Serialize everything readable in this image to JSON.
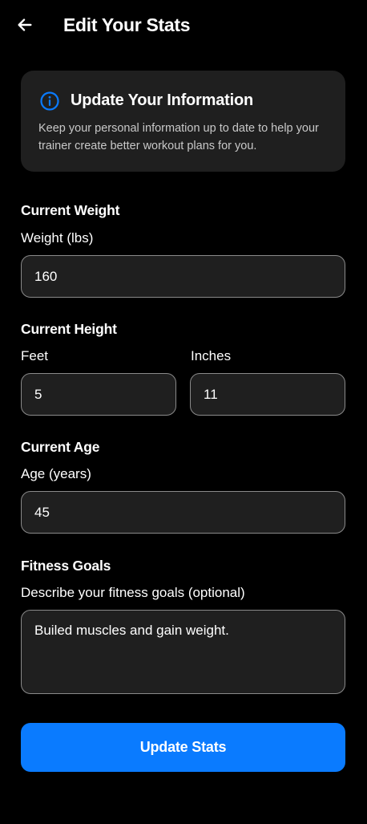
{
  "header": {
    "back_icon": "arrow-left-icon",
    "title": "Edit Your Stats"
  },
  "info_card": {
    "icon": "info-circle-icon",
    "icon_color": "#0a7bff",
    "title": "Update Your Information",
    "text": "Keep your personal information up to date to help your trainer create better workout plans for you."
  },
  "weight": {
    "section_title": "Current Weight",
    "label": "Weight (lbs)",
    "value": "160"
  },
  "height": {
    "section_title": "Current Height",
    "feet_label": "Feet",
    "feet_value": "5",
    "inches_label": "Inches",
    "inches_value": "11"
  },
  "age": {
    "section_title": "Current Age",
    "label": "Age (years)",
    "value": "45"
  },
  "goals": {
    "section_title": "Fitness Goals",
    "label": "Describe your fitness goals (optional)",
    "value": "Builed muscles and gain weight."
  },
  "submit": {
    "label": "Update Stats",
    "color": "#0a7bff"
  },
  "theme": {
    "background": "#000000",
    "surface": "#1f1f1f",
    "border": "#8a8a8a"
  }
}
